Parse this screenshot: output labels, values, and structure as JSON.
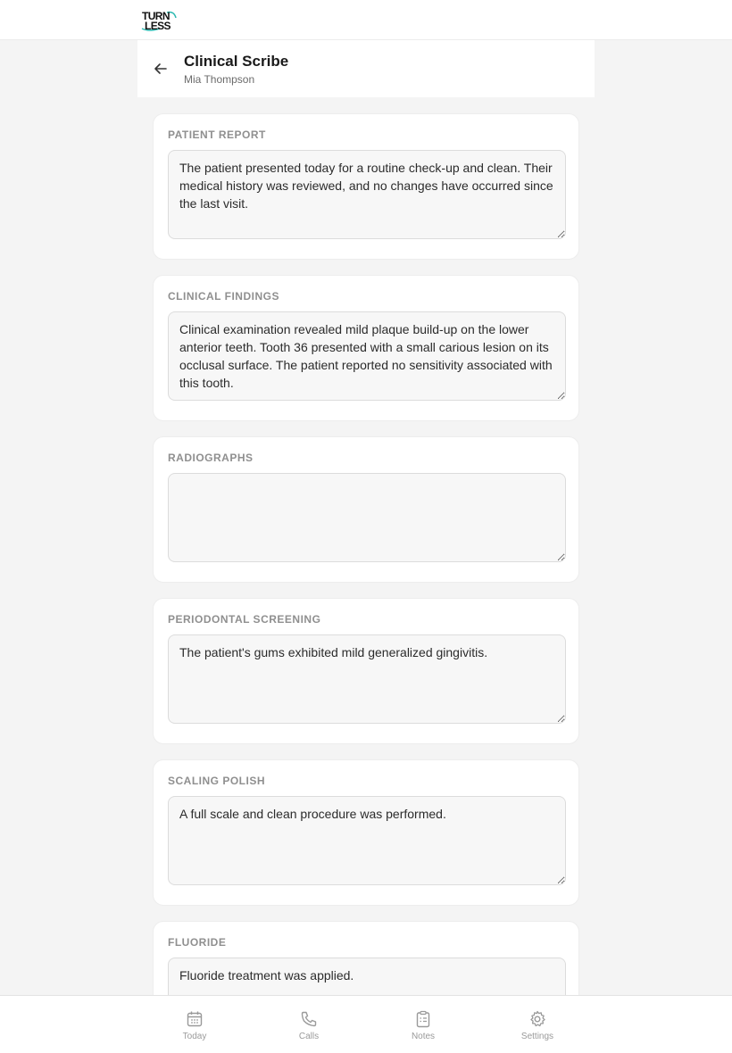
{
  "brand": {
    "logo_line1": "TURN",
    "logo_line2": "LESS",
    "accent": "#2bb8b0"
  },
  "header": {
    "title": "Clinical Scribe",
    "patient_name": "Mia Thompson"
  },
  "sections": [
    {
      "label": "PATIENT REPORT",
      "value": "The patient presented today for a routine check-up and clean. Their medical history was reviewed, and no changes have occurred since the last visit."
    },
    {
      "label": "CLINICAL FINDINGS",
      "value": "Clinical examination revealed mild plaque build-up on the lower anterior teeth. Tooth 36 presented with a small carious lesion on its occlusal surface. The patient reported no sensitivity associated with this tooth."
    },
    {
      "label": "RADIOGRAPHS",
      "value": ""
    },
    {
      "label": "PERIODONTAL SCREENING",
      "value": "The patient's gums exhibited mild generalized gingivitis."
    },
    {
      "label": "SCALING POLISH",
      "value": "A full scale and clean procedure was performed."
    },
    {
      "label": "FLUORIDE",
      "value": "Fluoride treatment was applied."
    }
  ],
  "nav": [
    {
      "label": "Today",
      "icon": "calendar-icon"
    },
    {
      "label": "Calls",
      "icon": "phone-icon"
    },
    {
      "label": "Notes",
      "icon": "clipboard-icon"
    },
    {
      "label": "Settings",
      "icon": "gear-icon"
    }
  ]
}
